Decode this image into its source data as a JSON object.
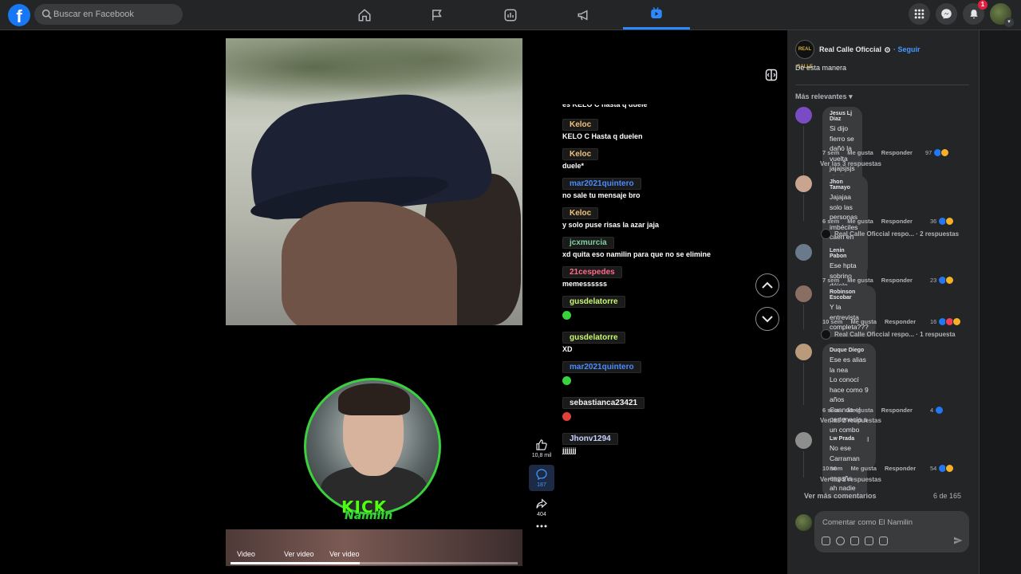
{
  "topbar": {
    "logo": "f",
    "search_placeholder": "Buscar en Facebook",
    "nav": [
      "home-icon",
      "flag-icon",
      "ads-icon",
      "megaphone-icon",
      "video-icon"
    ],
    "notification_count": "1"
  },
  "video": {
    "labels": [
      "Video",
      "Ver video",
      "Ver video"
    ],
    "progress": 0.45,
    "overlay_brand": "KICK",
    "overlay_name": "Namilin"
  },
  "chat": [
    {
      "user": "",
      "text": "es KELO C hasta q duele",
      "color": "#ffffff"
    },
    {
      "user": "Keloc",
      "text": "KELO C Hasta q duelen",
      "color": "#f0c27b"
    },
    {
      "user": "Keloc",
      "text": "duele*",
      "color": "#f0c27b"
    },
    {
      "user": "mar2021quintero",
      "text": "no sale tu mensaje bro",
      "color": "#4a8cff"
    },
    {
      "user": "Keloc",
      "text": "y solo puse risas la azar jaja",
      "color": "#f0c27b"
    },
    {
      "user": "jcxmurcia",
      "text": "xd quita eso namilin para que no se elimine",
      "color": "#7fd1a1"
    },
    {
      "user": "21cespedes",
      "text": "memessssss",
      "color": "#ff6b8a"
    },
    {
      "user": "gusdelatorre",
      "text": "",
      "emote": "#39d23c",
      "color": "#c9f76f"
    },
    {
      "user": "gusdelatorre",
      "text": "XD",
      "color": "#c9f76f"
    },
    {
      "user": "mar2021quintero",
      "text": "",
      "emote": "#39d23c",
      "color": "#4a8cff"
    },
    {
      "user": "sebastianca23421",
      "text": "",
      "emote": "#e0413b",
      "color": "#f1f1f1"
    },
    {
      "user": "Jhonv1294",
      "text": "jjjjjjj",
      "color": "#c7d2ff"
    }
  ],
  "actions": {
    "likes": "10,8 mil",
    "comments": "187",
    "shares": "404"
  },
  "panel": {
    "page_name": "Real Calle Oficcial",
    "page_avatar_text": "REAL CALLE",
    "follow": "Seguir",
    "post_text": "De esta manera",
    "sort_label": "Más relevantes",
    "comments": [
      {
        "name": "Jesus Lj Diaz",
        "body": [
          "Si dijo fierro se dañó la vuelta jajajsjsjs",
          "😂😂😂"
        ],
        "time": "7 sem",
        "reactions": "97",
        "replies": "Ver las 3 respuestas",
        "avatar": "#7a4cc4"
      },
      {
        "name": "Jhon Tamayo",
        "body": [
          "Jajajaa solo las personas imbéciles",
          "caen en semejante estupidez 😂😂"
        ],
        "time": "6 sem",
        "reactions": "36",
        "reply_preview": "Real Calle Oficcial respo... · 2 respuestas",
        "avatar": "#c9a48e"
      },
      {
        "name": "Lenin Pabon",
        "body": [
          "Ese hpta sobrino déjelo encerrado"
        ],
        "time": "7 sem",
        "reactions": "23",
        "avatar": "#6b7a8a"
      },
      {
        "name": "Robinson Escobar",
        "body": [
          "Y la entrevista completa???"
        ],
        "time": "10 sem",
        "reactions": "16",
        "reply_preview": "Real Calle Oficcial respo... · 1 respuesta",
        "avatar": "#8a6e64"
      },
      {
        "name": "Duque Diego",
        "body": [
          "Ese es alias la nea",
          "Lo conocí hace como 9 años",
          "Cuando el pertenecía a un combo",
          "delincuencial de la comuna 13"
        ],
        "time": "6 sem",
        "reactions": "4",
        "replies": "Ver las 2 respuestas",
        "avatar": "#b99a7a"
      },
      {
        "name": "Lw Prada",
        "body": [
          "No ese Carraman no engaña ah nadie"
        ],
        "time": "10 sem",
        "reactions": "54",
        "replies": "Ver las 2 respuestas",
        "avatar": "#8e8e8e"
      }
    ],
    "meta_like": "Me gusta",
    "meta_reply": "Responder",
    "more_comments": "Ver más comentarios",
    "count": "6 de 165",
    "composer_placeholder": "Comentar como El Namilin"
  }
}
